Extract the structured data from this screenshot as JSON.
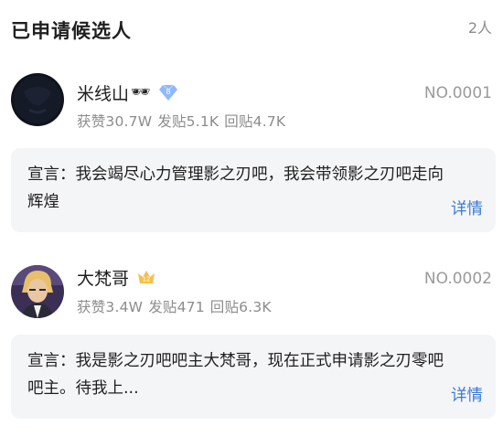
{
  "header": {
    "title": "已申请候选人",
    "count": "2人"
  },
  "candidates": [
    {
      "name": "米线山",
      "name_emoji": "🕶",
      "badge": {
        "type": "diamond",
        "level": "8",
        "color": "#8fb8ff"
      },
      "stats": {
        "likes": "获赞30.7W",
        "posts": "发贴5.1K",
        "replies": "回贴4.7K"
      },
      "number": "NO.0001",
      "declaration": "宣言：我会竭尽心力管理影之刃吧，我会带领影之刃吧走向辉煌",
      "details_label": "详情"
    },
    {
      "name": "大梵哥",
      "badge": {
        "type": "crown",
        "level": "12",
        "color": "#f5c04a"
      },
      "stats": {
        "likes": "获赞3.4W",
        "posts": "发贴471",
        "replies": "回贴6.3K"
      },
      "number": "NO.0002",
      "declaration": "宣言：我是影之刃吧吧主大梵哥，现在正式申请影之刃零吧吧主。待我上...",
      "details_label": "详情"
    }
  ]
}
